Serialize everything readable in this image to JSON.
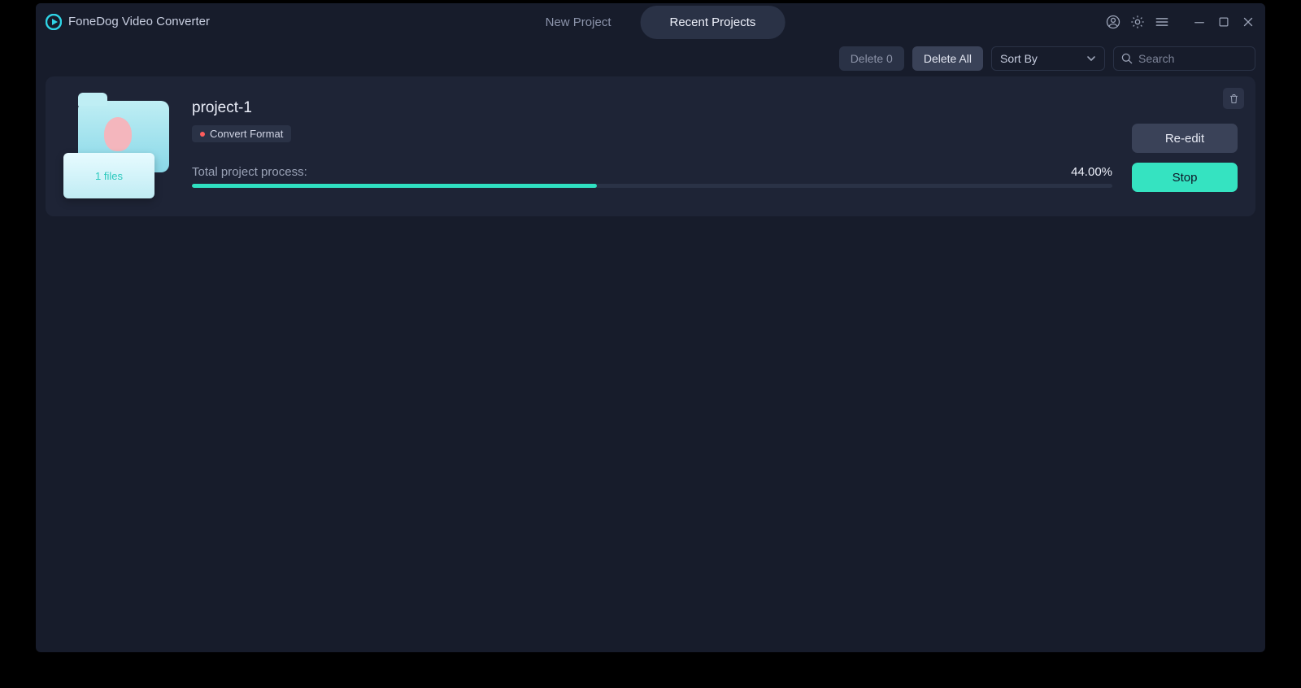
{
  "brand": {
    "name": "FoneDog Video Converter"
  },
  "tabs": {
    "new": "New Project",
    "recent": "Recent Projects",
    "active": "recent"
  },
  "toolbar": {
    "delete_count_label": "Delete 0",
    "delete_all_label": "Delete All",
    "sort_by_label": "Sort By",
    "search_placeholder": "Search"
  },
  "project": {
    "title": "project-1",
    "tag": "Convert Format",
    "files_label": "1 files",
    "progress_label": "Total project process:",
    "progress_pct_text": "44.00%",
    "progress_pct_value": 44,
    "actions": {
      "reedit": "Re-edit",
      "stop": "Stop"
    }
  },
  "colors": {
    "accent": "#35e3c1",
    "panel": "#1e2436",
    "bg": "#171c2b"
  }
}
